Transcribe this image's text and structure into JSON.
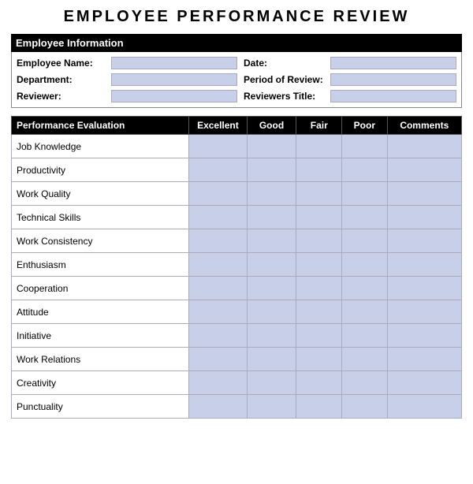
{
  "title": "EMPLOYEE  PERFORMANCE  REVIEW",
  "sections": {
    "info_header": "Employee Information",
    "fields": {
      "employee_name_label": "Employee Name:",
      "date_label": "Date:",
      "department_label": "Department:",
      "period_label": "Period of Review:",
      "reviewer_label": "Reviewer:",
      "reviewer_title_label": "Reviewers Title:"
    }
  },
  "table": {
    "headers": {
      "category": "Performance Evaluation",
      "excellent": "Excellent",
      "good": "Good",
      "fair": "Fair",
      "poor": "Poor",
      "comments": "Comments"
    },
    "rows": [
      "Job Knowledge",
      "Productivity",
      "Work Quality",
      "Technical Skills",
      "Work Consistency",
      "Enthusiasm",
      "Cooperation",
      "Attitude",
      "Initiative",
      "Work Relations",
      "Creativity",
      "Punctuality"
    ]
  }
}
